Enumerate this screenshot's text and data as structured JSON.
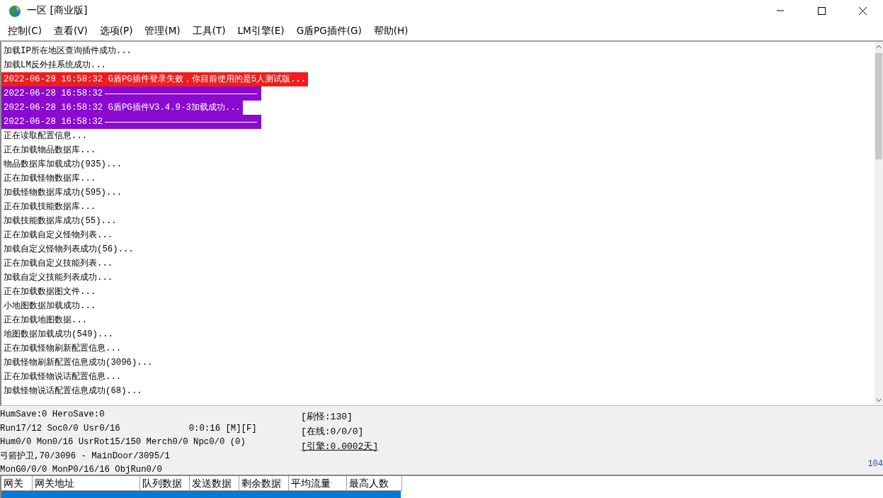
{
  "window": {
    "title": "一区 [商业版]"
  },
  "menu": [
    "控制(C)",
    "查看(V)",
    "选项(P)",
    "管理(M)",
    "工具(T)",
    "LM引擎(E)",
    "G盾PG插件(G)",
    "帮助(H)"
  ],
  "log": [
    {
      "kind": "normal",
      "text": "加载IP所在地区查询插件成功..."
    },
    {
      "kind": "normal",
      "text": "加载LM反外挂系统成功..."
    },
    {
      "kind": "error",
      "text": "2022-06-28 16:58:32 G盾PG插件登录失败，你目前使用的是5人测试版..."
    },
    {
      "kind": "separator",
      "text": "2022-06-28 16:58:32"
    },
    {
      "kind": "highlight",
      "text": "2022-06-28 16:58:32 G盾PG插件V3.4.9-3加载成功..."
    },
    {
      "kind": "separator",
      "text": "2022-06-28 16:58:32"
    },
    {
      "kind": "normal",
      "text": "正在读取配置信息..."
    },
    {
      "kind": "normal",
      "text": "正在加载物品数据库..."
    },
    {
      "kind": "normal",
      "text": "物品数据库加载成功(935)..."
    },
    {
      "kind": "normal",
      "text": "正在加载怪物数据库..."
    },
    {
      "kind": "normal",
      "text": "加载怪物数据库成功(595)..."
    },
    {
      "kind": "normal",
      "text": "正在加载技能数据库..."
    },
    {
      "kind": "normal",
      "text": "加载技能数据库成功(55)..."
    },
    {
      "kind": "normal",
      "text": "正在加载自定义怪物列表..."
    },
    {
      "kind": "normal",
      "text": "加载自定义怪物列表成功(56)..."
    },
    {
      "kind": "normal",
      "text": "正在加载自定义技能列表..."
    },
    {
      "kind": "normal",
      "text": "加载自定义技能列表成功..."
    },
    {
      "kind": "normal",
      "text": "正在加载数据图文件..."
    },
    {
      "kind": "normal",
      "text": "小地图数据加载成功..."
    },
    {
      "kind": "normal",
      "text": "正在加载地图数据..."
    },
    {
      "kind": "normal",
      "text": "地图数据加载成功(549)..."
    },
    {
      "kind": "normal",
      "text": "正在加载怪物刷新配置信息..."
    },
    {
      "kind": "normal",
      "text": "加载怪物刷新配置信息成功(3096)..."
    },
    {
      "kind": "normal",
      "text": "正在加载怪物说话配置信息..."
    },
    {
      "kind": "normal",
      "text": "加载怪物说话配置信息成功(68)..."
    }
  ],
  "status": {
    "lines": [
      "HumSave:0 HeroSave:0",
      "Run17/12 Soc0/0 Usr0/16",
      "Hum0/0 Mon0/16 UsrRot15/150 Merch0/0 Npc0/0 (0)",
      "弓箭护卫,70/3096 - MainDoor/3095/1",
      "MonG0/0/0 MonP0/16/16 ObjRun0/0"
    ],
    "clock": "0:0:16 [M][F]",
    "counters": [
      {
        "kind": "plain",
        "text": "[刷怪:130]"
      },
      {
        "kind": "plain",
        "text": "[在线:0/0/0]"
      },
      {
        "kind": "link",
        "text": "[引擎:0.0002天]"
      }
    ],
    "edge_text": "104"
  },
  "gate_table": {
    "columns": [
      "网关",
      "网关地址",
      "队列数据",
      "发送数据",
      "剩余数据",
      "平均流量",
      "最高人数"
    ]
  }
}
